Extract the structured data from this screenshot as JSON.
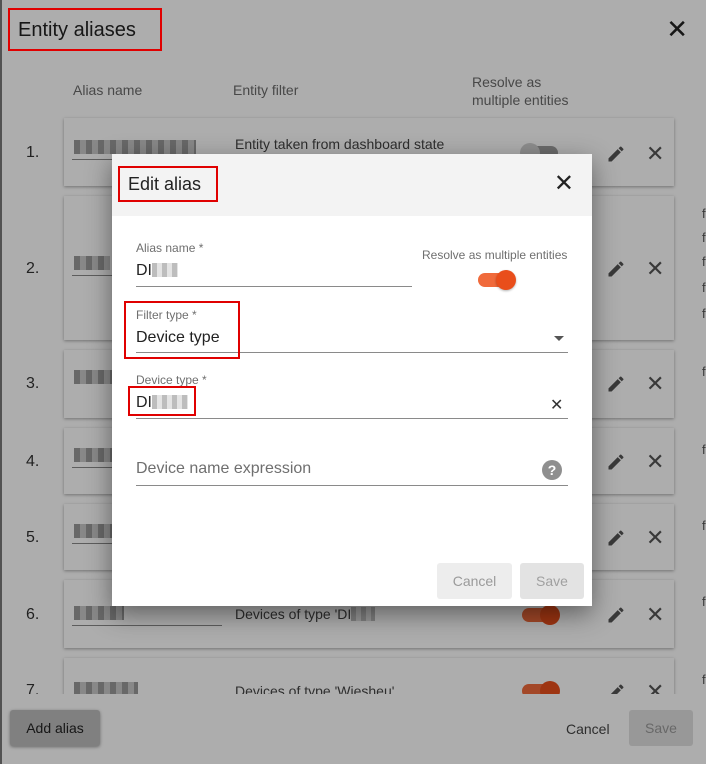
{
  "outer_dialog": {
    "title": "Entity aliases",
    "columns": {
      "alias_name": "Alias name",
      "entity_filter": "Entity filter",
      "resolve_line1": "Resolve as",
      "resolve_line2": "multiple entities"
    },
    "rows": [
      {
        "num": "1.",
        "filter": "Entity taken from dashboard state",
        "resolve": false
      },
      {
        "num": "2.",
        "filter": "",
        "resolve": true
      },
      {
        "num": "3.",
        "filter": "",
        "resolve": true
      },
      {
        "num": "4.",
        "filter": "",
        "resolve": true
      },
      {
        "num": "5.",
        "filter": "",
        "resolve": true
      },
      {
        "num": "6.",
        "filter": "Devices of type 'DI",
        "resolve": true
      },
      {
        "num": "7.",
        "filter": "Devices of type 'Wiesheu'",
        "resolve": true
      }
    ],
    "edge_char": "f",
    "add_alias_label": "Add alias",
    "cancel_label": "Cancel",
    "save_label": "Save"
  },
  "edit_alias": {
    "title": "Edit alias",
    "alias_name_label": "Alias name *",
    "alias_name_value": "DI",
    "resolve_label": "Resolve as multiple entities",
    "resolve_on": true,
    "filter_type_label": "Filter type *",
    "filter_type_value": "Device type",
    "device_type_label": "Device type *",
    "device_type_value": "DI",
    "device_name_placeholder": "Device name expression",
    "cancel_label": "Cancel",
    "save_label": "Save"
  },
  "icons": {
    "close": "close-icon",
    "edit": "pencil-icon",
    "delete": "close-icon",
    "dropdown": "chevron-down-icon",
    "clear": "clear-icon",
    "help": "help-icon"
  },
  "colors": {
    "accent": "#f06a3b",
    "highlight_box": "#e00000"
  }
}
